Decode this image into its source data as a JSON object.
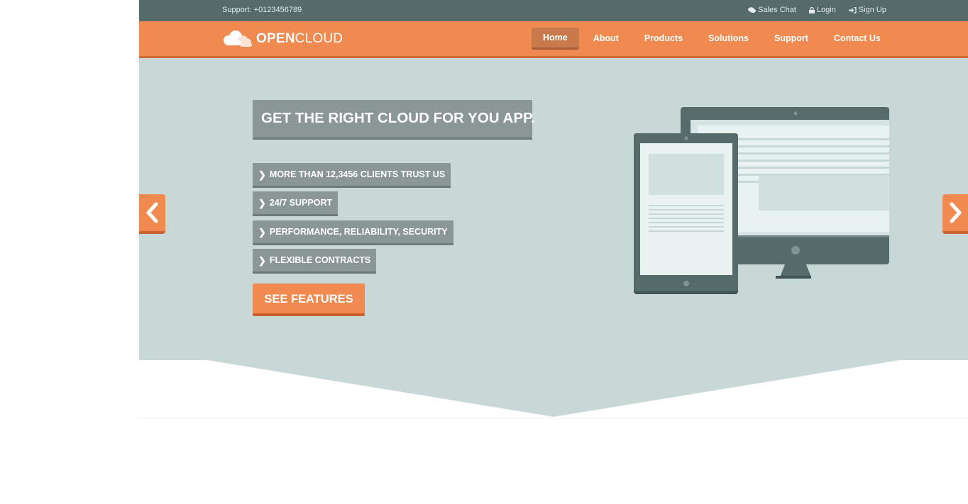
{
  "topbar": {
    "support": "Support: +0123456789",
    "links": [
      {
        "icon": "chat-icon",
        "label": "Sales Chat"
      },
      {
        "icon": "lock-icon",
        "label": "Login"
      },
      {
        "icon": "sign-in-icon",
        "label": "Sign Up"
      }
    ]
  },
  "brand": {
    "bold": "OPEN",
    "light": "CLOUD",
    "icon": "cloud-icon"
  },
  "nav": {
    "active": "Home",
    "items": [
      "Home",
      "About",
      "Products",
      "Solutions",
      "Support",
      "Contact Us"
    ]
  },
  "hero": {
    "headline": "GET THE RIGHT CLOUD FOR YOU APP.",
    "features": [
      "MORE THAN 12,3456 CLIENTS TRUST US",
      "24/7 SUPPORT",
      "PERFORMANCE, RELIABILITY, SECURITY",
      "FLEXIBLE CONTRACTS"
    ],
    "cta": "SEE FEATURES",
    "prev_icon": "chevron-left-icon",
    "next_icon": "chevron-right-icon"
  },
  "colors": {
    "topbar": "#546b6a",
    "accent": "#f18a50",
    "hero_bg": "#c7d8d6",
    "label_bg": "#8a9796"
  }
}
